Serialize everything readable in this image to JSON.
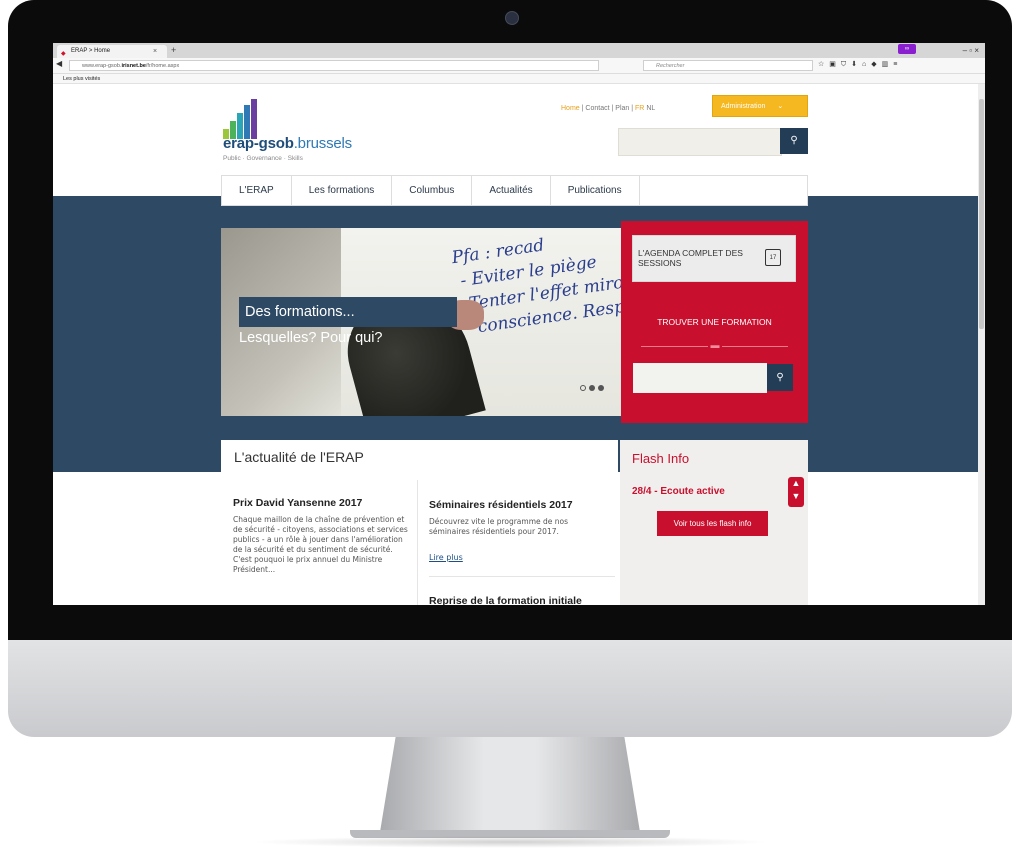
{
  "browser": {
    "tab_title": "ERAP > Home",
    "tab_close": "×",
    "new_tab": "+",
    "url_prefix": "www.erap-gsob.",
    "url_domain": "irisnet.be",
    "url_path": "/fr/home.aspx",
    "search_placeholder": "Rechercher",
    "bookmarks_label": "Les plus visités",
    "window_controls": "–   ▫   ×"
  },
  "site": {
    "logo_main": "erap-gsob",
    "logo_domain": ".brussels",
    "logo_tagline": "Public · Governance · Skills",
    "top_links": {
      "home": "Home",
      "contact": "Contact",
      "plan": "Plan",
      "fr": "FR",
      "nl": "NL",
      "sep": "|"
    },
    "admin_label": "Administration",
    "admin_caret": "⌄",
    "nav": [
      "L'ERAP",
      "Les formations",
      "Columbus",
      "Actualités",
      "Publications"
    ],
    "hero": {
      "handwriting": "Pfa : recad\n - Eviter le piège\n -Tenter l'effet miroi\n   conscience. Respon",
      "caption_line1": "Des formations...",
      "caption_line2": "Lesquelles? Pour qui?"
    },
    "agenda": {
      "label": "L'AGENDA COMPLET DES SESSIONS",
      "calendar_day": "17"
    },
    "find_training_label": "TROUVER UNE FORMATION",
    "news": {
      "title": "L'actualité de l'ERAP",
      "article1": {
        "title": "Prix David Yansenne 2017",
        "body": "Chaque maillon de la chaîne de prévention et de sécurité - citoyens, associations et services publics - a un rôle à jouer dans l'amélioration de la sécurité et du sentiment de sécurité. C'est pouquoi le prix annuel du Ministre Président..."
      },
      "article2": {
        "title": "Séminaires résidentiels 2017",
        "body": "Découvrez vite le programme de nos séminaires résidentiels pour 2017.",
        "link": "Lire plus"
      },
      "article3": {
        "title": "Reprise de la formation initiale"
      }
    },
    "flash": {
      "title": "Flash Info",
      "item": "28/4 - Ecoute active",
      "button": "Voir tous les flash info"
    }
  },
  "colors": {
    "brand_dark": "#2e4963",
    "brand_red": "#c8102e",
    "accent_yellow": "#f5b820"
  }
}
